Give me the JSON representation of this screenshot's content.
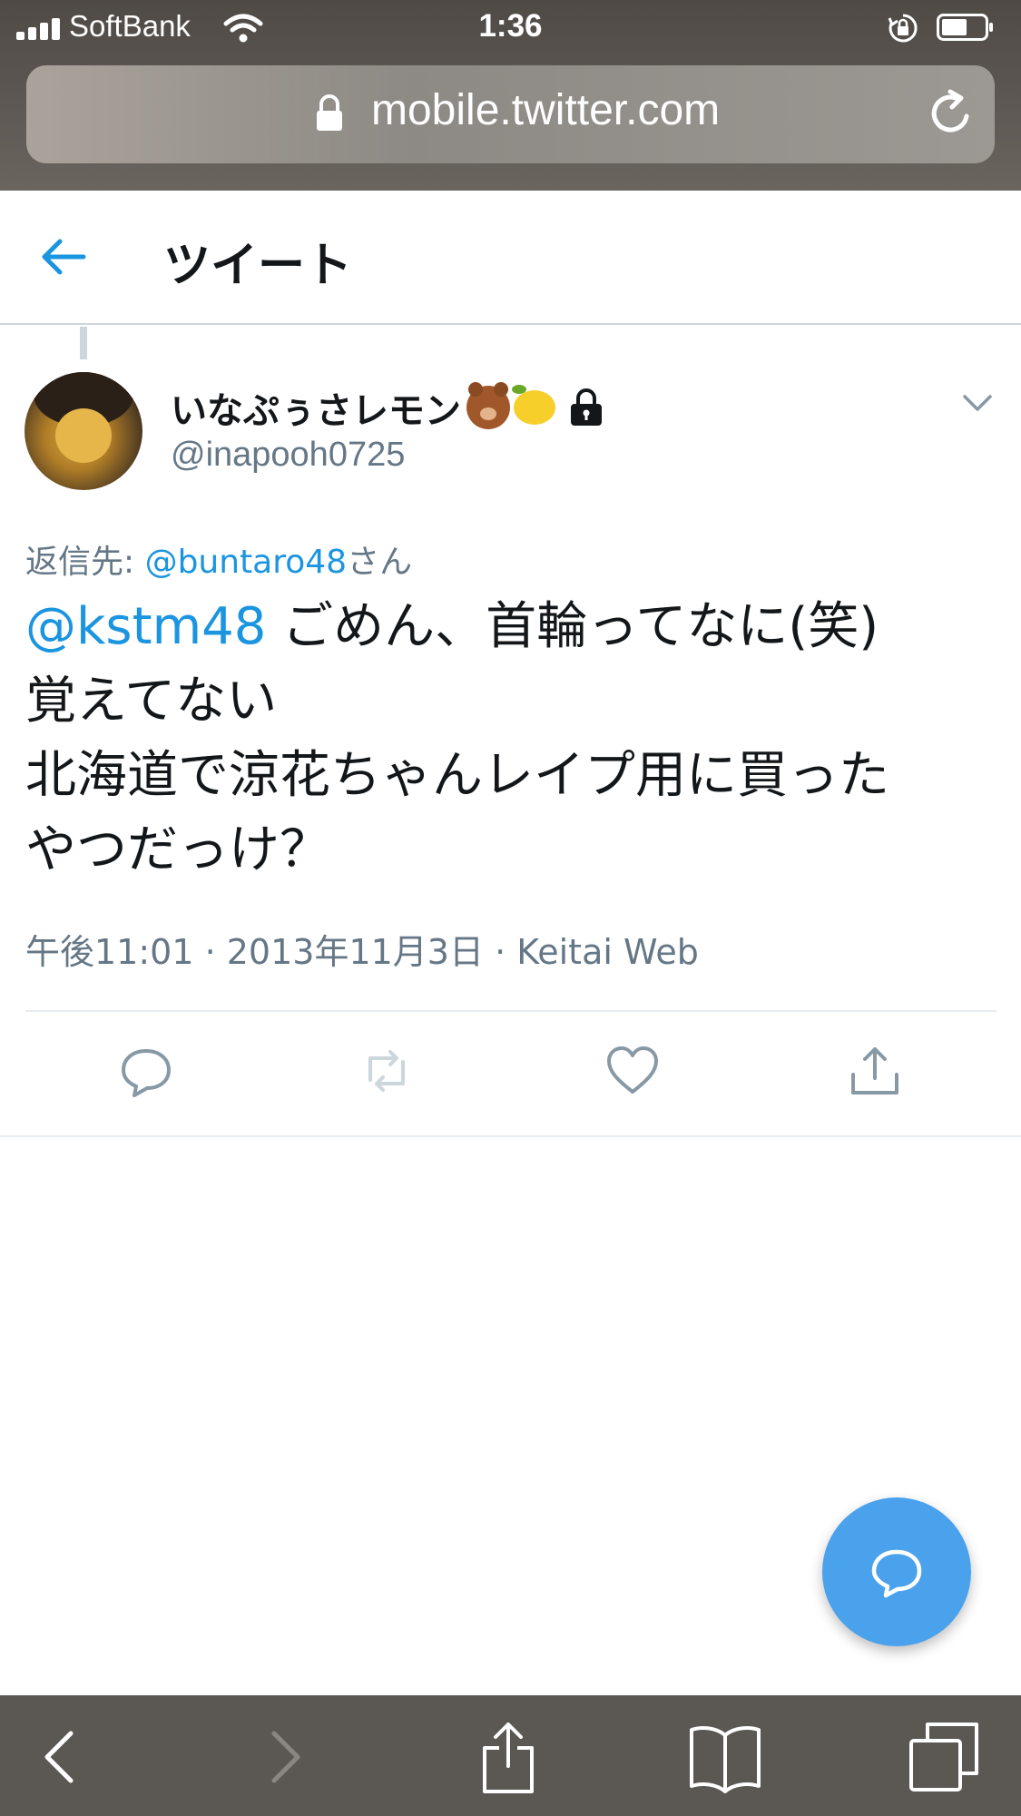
{
  "status_bar": {
    "carrier": "SoftBank",
    "time": "1:36",
    "icons": [
      "signal-icon",
      "wifi-icon",
      "rotation-lock-icon",
      "battery-icon"
    ]
  },
  "browser": {
    "url": "mobile.twitter.com",
    "icons": [
      "lock-icon",
      "reload-icon"
    ],
    "toolbar_icons": [
      "back-icon",
      "forward-icon",
      "share-icon",
      "bookmarks-icon",
      "tabs-icon"
    ]
  },
  "header": {
    "title": "ツイート",
    "back_icon": "arrow-left-icon"
  },
  "tweet": {
    "display_name": "いなぷぅさレモン",
    "name_emojis": [
      "bear-face",
      "lemon"
    ],
    "protected_icon": "lock-icon",
    "username": "@inapooh0725",
    "reply_to_prefix": "返信先: ",
    "reply_to_mention": "@buntaro48",
    "reply_to_suffix": "さん",
    "text_mention": "@kstm48",
    "text_line1": " ごめん、首輪ってなに(笑)",
    "text_line2": "覚えてない",
    "text_line3": "北海道で涼花ちゃんレイプ用に買った",
    "text_line4": "やつだっけ？",
    "timestamp": "午後11:01 · 2013年11月3日 · Keitai Web",
    "actions": [
      "reply-icon",
      "retweet-icon",
      "like-icon",
      "share-icon"
    ]
  },
  "fab": {
    "icon": "compose-reply-icon"
  },
  "colors": {
    "accent": "#1b95e0",
    "fab": "#4aa1ec",
    "secondary_text": "#657786",
    "divider": "#e6ecf0"
  }
}
